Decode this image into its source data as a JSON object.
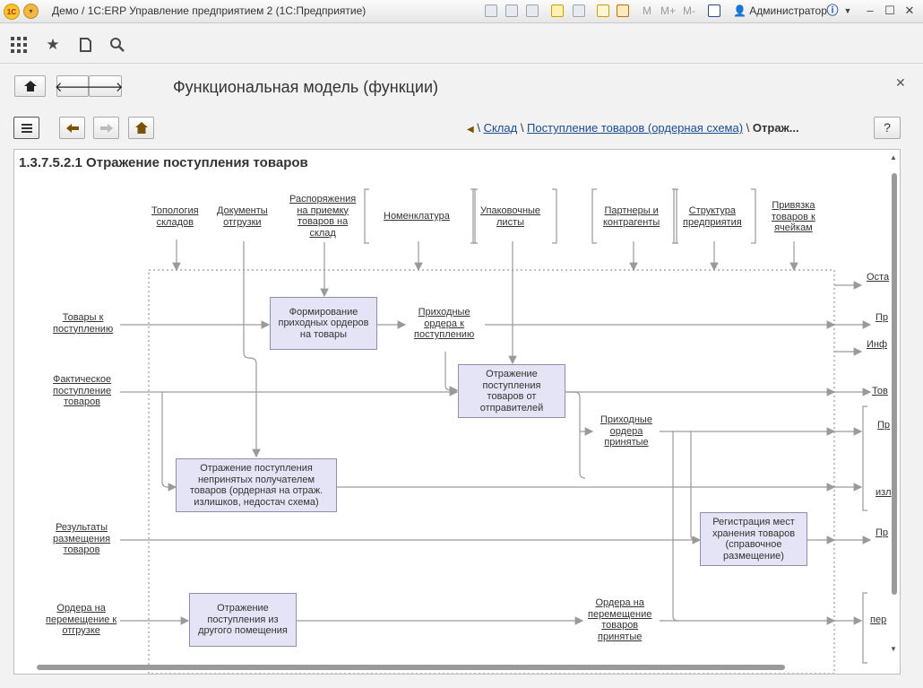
{
  "window": {
    "title": "Демо / 1С:ERP Управление предприятием 2  (1С:Предприятие)",
    "logo_text": "1С",
    "user": "Администратор",
    "m_buttons": [
      "M",
      "M+",
      "M-"
    ]
  },
  "form": {
    "title": "Функциональная модель (функции)"
  },
  "breadcrumb": {
    "root": "Склад",
    "middle": "Поступление товаров (ордерная схема)",
    "current": "Отраж...",
    "help": "?"
  },
  "diagram": {
    "title": "1.3.7.5.2.1 Отражение поступления товаров",
    "controls": [
      "Топология\nскладов",
      "Документы\nотгрузки",
      "Распоряжения\nна приемку\nтоваров на\nсклад",
      "Номенклатура",
      "Упаковочные\nлисты",
      "Партнеры и\nконтрагенты",
      "Структура\nпредприятия",
      "Привязка\nтоваров к\nячейкам"
    ],
    "inputs": [
      "Товары к\nпоступлению",
      "Фактическое\nпоступление\nтоваров",
      "Результаты\nразмещения\nтоваров",
      "Ордера на\nперемещение к\nотгрузке"
    ],
    "boxes": [
      "Формирование\nприходных ордеров\nна товары",
      "Отражение\nпоступления\nтоваров от\nотправителей",
      "Отражение поступления\nнепринятых получателем\nтоваров (ордерная на отраж.\nизлишков, недостач схема)",
      "Регистрация мест\nхранения товаров\n(справочное\nразмещение)",
      "Отражение\nпоступления из\nдругого помещения"
    ],
    "intermediate": [
      "Приходные\nордера к\nпоступлению",
      "Приходные\nордера\nпринятые",
      "Ордера на\nперемещение\nтоваров\nпринятые"
    ],
    "outputs": [
      "Оста",
      "Пр",
      "Инф",
      "Тов",
      "Пр",
      "изл",
      "Пр",
      "пер"
    ]
  }
}
